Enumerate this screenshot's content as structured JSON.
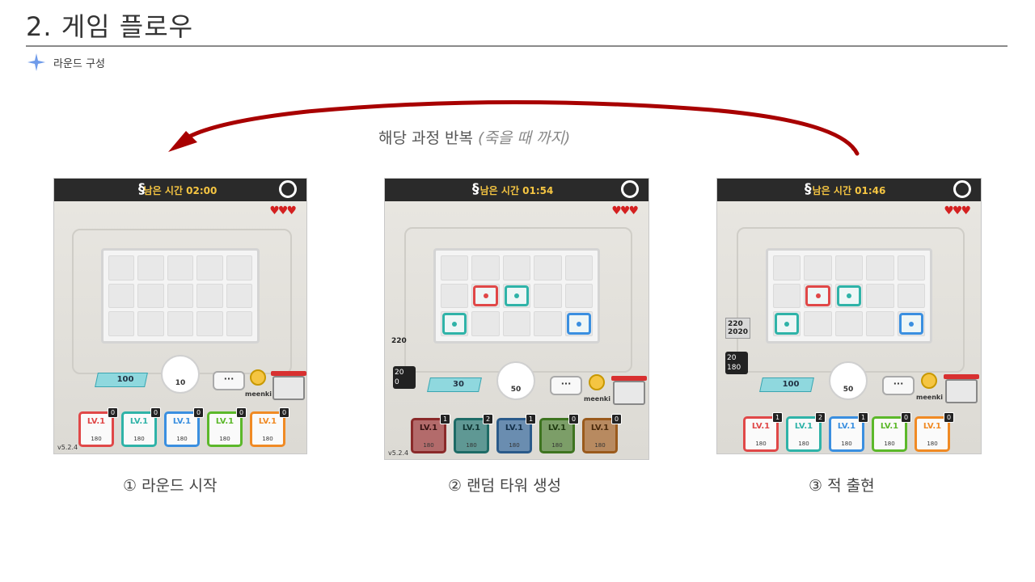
{
  "header": {
    "title": "2. 게임 플로우",
    "subtitle": "라운드 구성"
  },
  "loop": {
    "main": "해당 과정 반복",
    "note": "(죽을 때 까지)"
  },
  "shots": [
    {
      "timer_label": "남은 시간 02:00",
      "sp": "100",
      "spawn_cost": "10",
      "user": "meenki",
      "version": "v5.2.4",
      "cards": [
        {
          "lv": "LV.1",
          "cost": "180",
          "count": "0"
        },
        {
          "lv": "LV.1",
          "cost": "180",
          "count": "0"
        },
        {
          "lv": "LV.1",
          "cost": "180",
          "count": "0"
        },
        {
          "lv": "LV.1",
          "cost": "180",
          "count": "0"
        },
        {
          "lv": "LV.1",
          "cost": "180",
          "count": "0"
        }
      ]
    },
    {
      "timer_label": "남은 시간 01:54",
      "sp": "30",
      "spawn_cost": "50",
      "user": "meenki",
      "version": "v5.2.4",
      "enemy_hp": "220",
      "wave_box": "20\n0",
      "cards": [
        {
          "lv": "LV.1",
          "cost": "180",
          "count": "1"
        },
        {
          "lv": "LV.1",
          "cost": "180",
          "count": "2"
        },
        {
          "lv": "LV.1",
          "cost": "180",
          "count": "1"
        },
        {
          "lv": "LV.1",
          "cost": "180",
          "count": "0"
        },
        {
          "lv": "LV.1",
          "cost": "180",
          "count": "0"
        }
      ]
    },
    {
      "timer_label": "남은 시간 01:46",
      "sp": "100",
      "spawn_cost": "50",
      "user": "meenki",
      "version": "",
      "enemy_hp": "220\n2020",
      "wave_box": "20\n180",
      "cards": [
        {
          "lv": "LV.1",
          "cost": "180",
          "count": "1"
        },
        {
          "lv": "LV.1",
          "cost": "180",
          "count": "2"
        },
        {
          "lv": "LV.1",
          "cost": "180",
          "count": "1"
        },
        {
          "lv": "LV.1",
          "cost": "180",
          "count": "0"
        },
        {
          "lv": "LV.1",
          "cost": "180",
          "count": "0"
        }
      ]
    }
  ],
  "captions": [
    "① 라운드 시작",
    "② 랜덤 타워 생성",
    "③ 적 출현"
  ],
  "colors": {
    "arrow": "#a80000",
    "card_colors": [
      "#e04848",
      "#2fb3a8",
      "#3a8fe0",
      "#5cb82a",
      "#f08a24"
    ],
    "dim_card_colors": [
      "#8a2a2a",
      "#1e6b66",
      "#2a5a8a",
      "#3e7420",
      "#9a5a1c"
    ]
  }
}
